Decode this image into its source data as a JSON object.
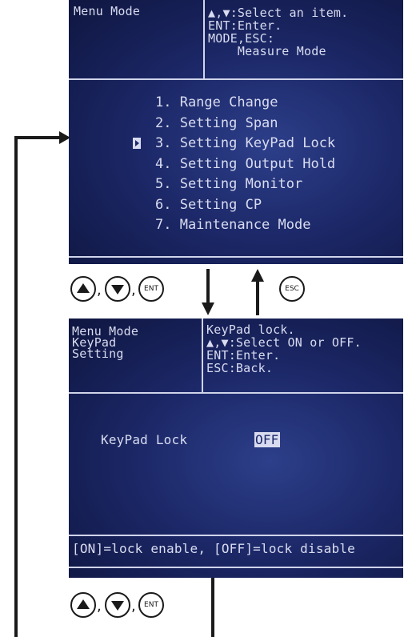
{
  "top_screen": {
    "header_left": "Menu Mode",
    "header_right": [
      "▲,▼:Select an item.",
      "ENT:Enter.",
      "MODE,ESC:",
      "    Measure Mode"
    ],
    "menu_items": [
      "1. Range Change",
      "2. Setting Span",
      "3. Setting KeyPad Lock",
      "4. Setting Output Hold",
      "5. Setting Monitor",
      "6. Setting CP",
      "7. Maintenance Mode"
    ],
    "selected_index": 2
  },
  "bottom_screen": {
    "header_left": [
      "Menu Mode",
      "KeyPad",
      "Setting"
    ],
    "header_right": [
      "KeyPad lock.",
      "▲,▼:Select ON or OFF.",
      "ENT:Enter.",
      "ESC:Back."
    ],
    "keypad_label": "KeyPad Lock",
    "keypad_value": "OFF",
    "footer": "[ON]=lock enable, [OFF]=lock disable"
  },
  "buttons": {
    "ent": "ENT",
    "esc": "ESC",
    "separator": ","
  }
}
